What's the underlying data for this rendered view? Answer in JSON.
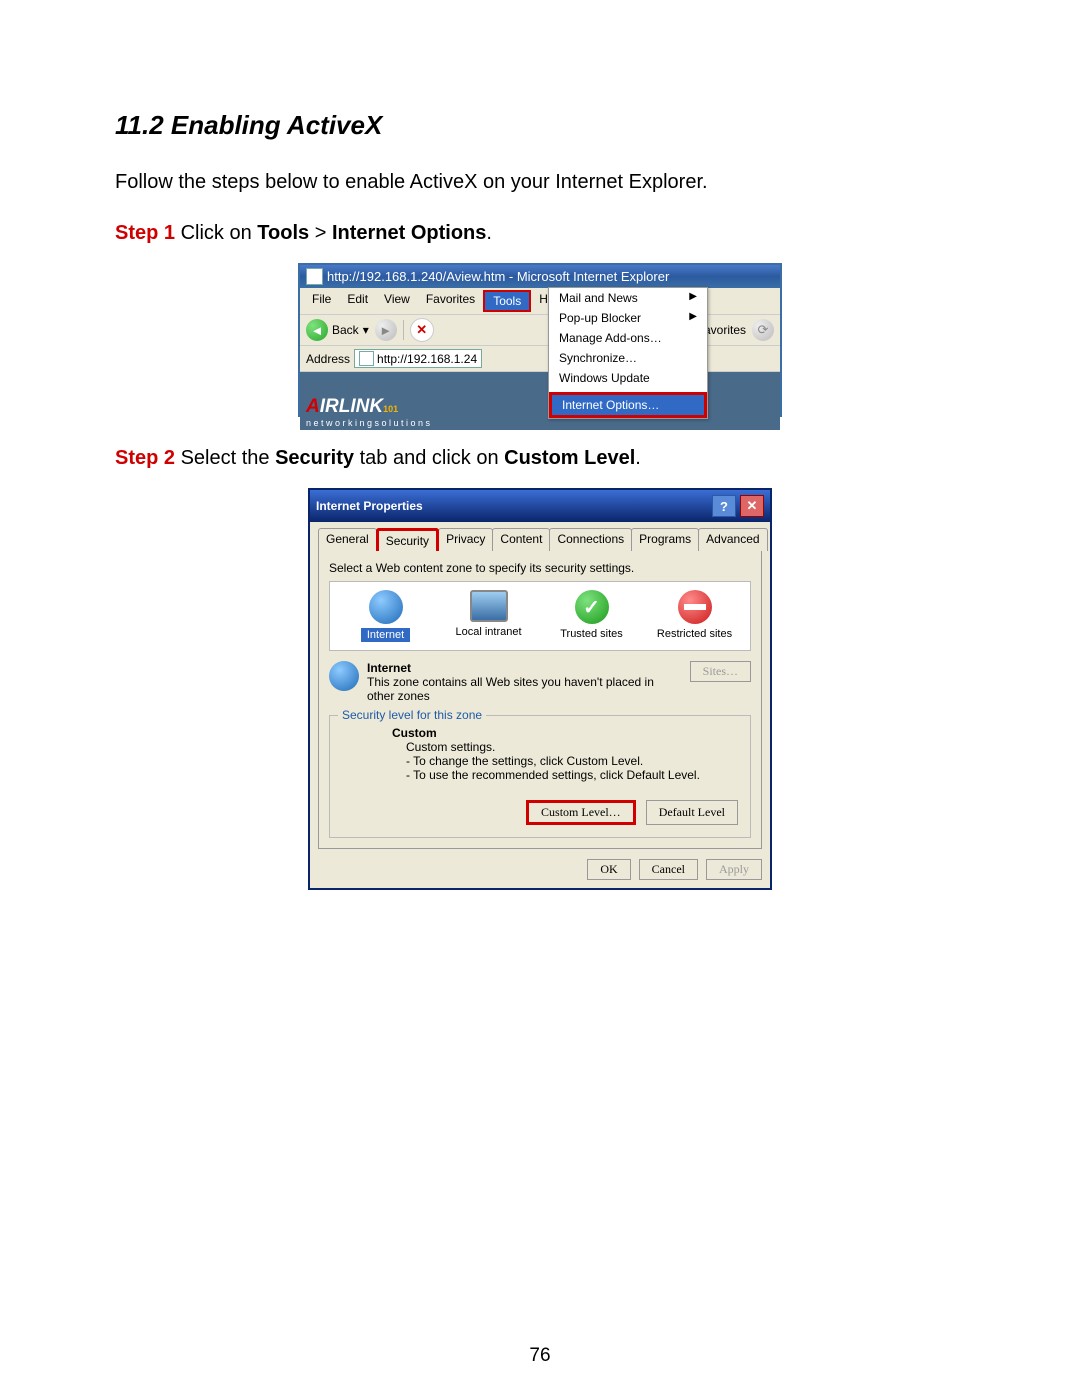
{
  "section_title": "11.2 Enabling ActiveX",
  "intro": "Follow the steps below to enable ActiveX on your Internet Explorer.",
  "step1": {
    "label": "Step 1",
    "before": " Click on ",
    "bold1": "Tools",
    "sep": " > ",
    "bold2": "Internet Options",
    "after": "."
  },
  "step2": {
    "label": "Step 2",
    "before": " Select the ",
    "bold1": "Security",
    "mid": " tab and click on ",
    "bold2": "Custom Level",
    "after": "."
  },
  "ie": {
    "title": "http://192.168.1.240/Aview.htm - Microsoft Internet Explorer",
    "menus": {
      "file": "File",
      "edit": "Edit",
      "view": "View",
      "favorites": "Favorites",
      "tools": "Tools",
      "help": "Help"
    },
    "back": "Back",
    "favorites_btn": "Favorites",
    "address_label": "Address",
    "address_value": "http://192.168.1.24",
    "tools_menu": {
      "mail": "Mail and News",
      "popup": "Pop-up Blocker",
      "addons": "Manage Add-ons…",
      "sync": "Synchronize…",
      "update": "Windows Update",
      "options": "Internet Options…"
    },
    "logo": {
      "brand_a": "A",
      "brand_rest": "IRLINK",
      "sub": "101",
      "tag": "n e t w o r k i n g s o l u t i o n s"
    }
  },
  "dlg": {
    "title": "Internet Properties",
    "tabs": {
      "general": "General",
      "security": "Security",
      "privacy": "Privacy",
      "content": "Content",
      "connections": "Connections",
      "programs": "Programs",
      "advanced": "Advanced"
    },
    "hint": "Select a Web content zone to specify its security settings.",
    "zones": {
      "internet": "Internet",
      "intranet": "Local intranet",
      "trusted": "Trusted sites",
      "restricted": "Restricted sites"
    },
    "zone_title": "Internet",
    "zone_desc": "This zone contains all Web sites you haven't placed in other zones",
    "sites_btn": "Sites…",
    "fieldset_legend": "Security level for this zone",
    "custom_title": "Custom",
    "custom_sub": "Custom settings.",
    "custom_l1": "- To change the settings, click Custom Level.",
    "custom_l2": "- To use the recommended settings, click Default Level.",
    "custom_level_btn": "Custom Level…",
    "default_level_btn": "Default Level",
    "ok": "OK",
    "cancel": "Cancel",
    "apply": "Apply"
  },
  "page_number": "76"
}
